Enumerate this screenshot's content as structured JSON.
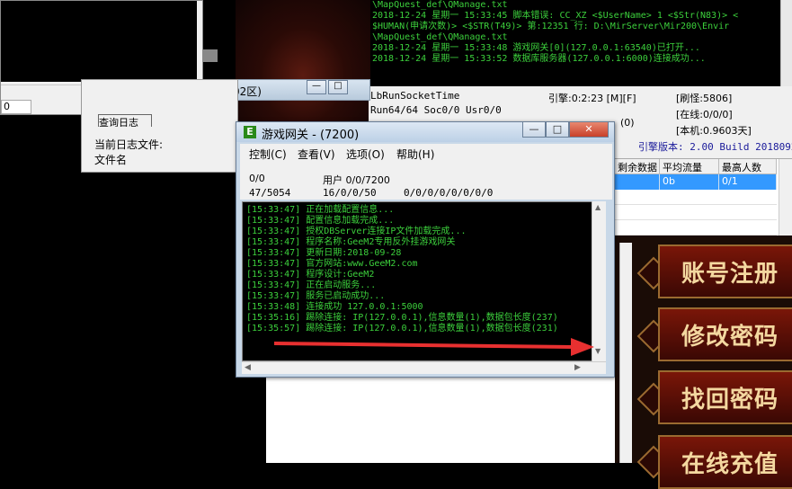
{
  "background": {
    "left_console_label": "",
    "bg_window_title": "丰公益02区)",
    "game_buttons": [
      "账号注册",
      "修改密码",
      "找回密码",
      "在线充值"
    ]
  },
  "log_top": {
    "lines": [
      "\\MapQuest_def\\QManage.txt",
      "2018-12-24 星期一 15:33:45 脚本错误: CC_XZ <$UserName> 1 <$Str(N83)> <",
      "$HUMAN(申请次数)> <$STR(T49)> 第:12351 行: D:\\MirServer\\Mir200\\Envir",
      "\\MapQuest_def\\QManage.txt",
      "2018-12-24 星期一 15:33:48 游戏网关[0](127.0.0.1:63540)已打开...",
      "2018-12-24 星期一 15:33:52 数据库服务器(127.0.0.1:6000)连接成功..."
    ]
  },
  "status": {
    "run_socket": "LbRunSocketTime",
    "run_stats": "Run64/64 Soc0/0 Usr0/0",
    "engine_time": "引擎:0:2:23 [M][F]",
    "refresh": "[刷怪:5806]",
    "online": "[在线:0/0/0]",
    "local": "[本机:0.9603天]",
    "engine_version": "引擎版本: 2.00 Build 20180928",
    "right_value": "(0)"
  },
  "table": {
    "headers": [
      "剩余数据",
      "平均流量",
      "最高人数"
    ],
    "row": [
      "",
      "0b",
      "0/1"
    ]
  },
  "logfile_window": {
    "current_label": "当前日志文件:",
    "file_label": "文件名",
    "tab_label": "查询日志"
  },
  "gate_window": {
    "title": "游戏网关 - (7200)",
    "icon_letter": "E",
    "menu": [
      "控制(C)",
      "查看(V)",
      "选项(O)",
      "帮助(H)"
    ],
    "info": {
      "conn": "0/0",
      "users": "用户 0/0/7200",
      "bytes": "47/5054",
      "queue": "16/0/0/50",
      "misc": "0/0/0/0/0/0/0/0"
    },
    "log_lines": [
      "[15:33:47] 正在加载配置信息...",
      "[15:33:47] 配置信息加载完成...",
      "[15:33:47] 授权DBServer连接IP文件加载完成...",
      "[15:33:47] 程序名称:GeeM2专用反外挂游戏网关",
      "[15:33:47] 更新日期:2018-09-28",
      "[15:33:47] 官方网站:www.GeeM2.com",
      "[15:33:47] 程序设计:GeeM2",
      "[15:33:47] 正在启动服务...",
      "[15:33:47] 服务已启动成功...",
      "[15:33:48] 连接成功 127.0.0.1:5000",
      "[15:35:16] 踢除连接: IP(127.0.0.1),信息数量(1),数据包长度(237)",
      "[15:35:57] 踢除连接: IP(127.0.0.1),信息数量(1),数据包长度(231)"
    ]
  }
}
